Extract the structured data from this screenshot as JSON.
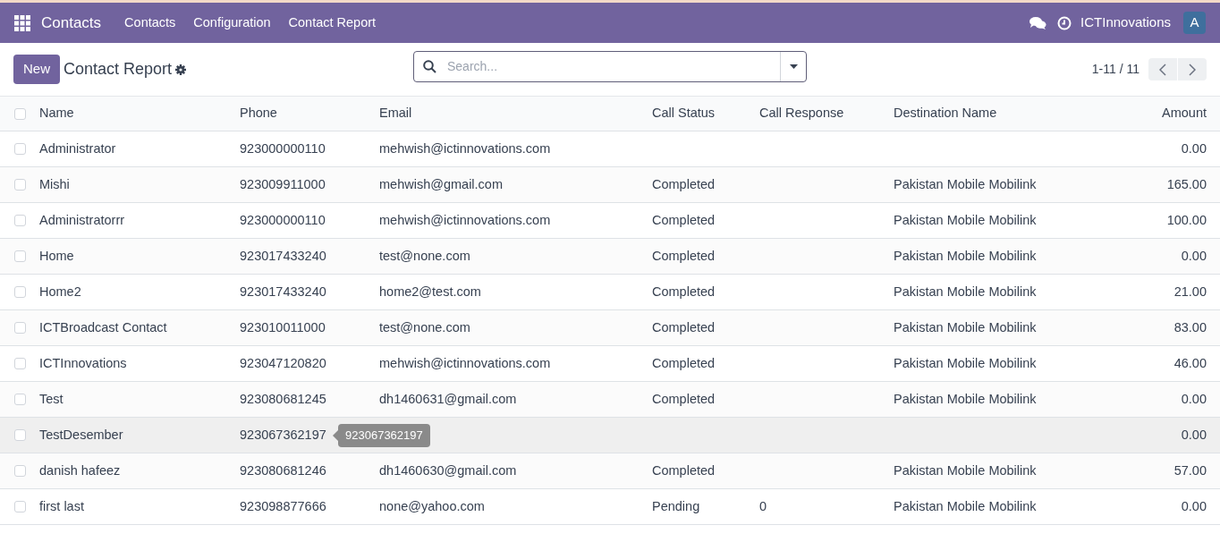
{
  "navbar": {
    "app_name": "Contacts",
    "menu": [
      "Contacts",
      "Configuration",
      "Contact Report"
    ],
    "company": "ICTInnovations",
    "avatar": "A"
  },
  "control_panel": {
    "new_button": "New",
    "title": "Contact Report",
    "search": {
      "placeholder": "Search..."
    },
    "pager": "1-11 / 11"
  },
  "table": {
    "select_all_checked": false,
    "columns": [
      "Name",
      "Phone",
      "Email",
      "Call Status",
      "Call Response",
      "Destination Name",
      "Amount"
    ],
    "rows": [
      {
        "cells": [
          "Administrator",
          "923000000110",
          "mehwish@ictinnovations.com",
          "",
          "",
          "",
          "0.00"
        ],
        "hovered": false,
        "checked": false
      },
      {
        "cells": [
          "Mishi",
          "923009911000",
          "mehwish@gmail.com",
          "Completed",
          "",
          "Pakistan Mobile Mobilink",
          "165.00"
        ],
        "hovered": false,
        "checked": false
      },
      {
        "cells": [
          "Administratorrr",
          "923000000110",
          "mehwish@ictinnovations.com",
          "Completed",
          "",
          "Pakistan Mobile Mobilink",
          "100.00"
        ],
        "hovered": false,
        "checked": false
      },
      {
        "cells": [
          "Home",
          "923017433240",
          "test@none.com",
          "Completed",
          "",
          "Pakistan Mobile Mobilink",
          "0.00"
        ],
        "hovered": false,
        "checked": false
      },
      {
        "cells": [
          "Home2",
          "923017433240",
          "home2@test.com",
          "Completed",
          "",
          "Pakistan Mobile Mobilink",
          "21.00"
        ],
        "hovered": false,
        "checked": false
      },
      {
        "cells": [
          "ICTBroadcast Contact",
          "923010011000",
          "test@none.com",
          "Completed",
          "",
          "Pakistan Mobile Mobilink",
          "83.00"
        ],
        "hovered": false,
        "checked": false
      },
      {
        "cells": [
          "ICTInnovations",
          "923047120820",
          "mehwish@ictinnovations.com",
          "Completed",
          "",
          "Pakistan Mobile Mobilink",
          "46.00"
        ],
        "hovered": false,
        "checked": false
      },
      {
        "cells": [
          "Test",
          "923080681245",
          "dh1460631@gmail.com",
          "Completed",
          "",
          "Pakistan Mobile Mobilink",
          "0.00"
        ],
        "hovered": false,
        "checked": false
      },
      {
        "cells": [
          "TestDesember",
          "923067362197",
          "",
          "",
          "",
          "",
          "0.00"
        ],
        "hovered": true,
        "checked": false,
        "tooltip": "923067362197"
      },
      {
        "cells": [
          "danish hafeez",
          "923080681246",
          "dh1460630@gmail.com",
          "Completed",
          "",
          "Pakistan Mobile Mobilink",
          "57.00"
        ],
        "hovered": false,
        "checked": false
      },
      {
        "cells": [
          "first last",
          "923098877666",
          "none@yahoo.com",
          "Pending",
          "0",
          "Pakistan Mobile Mobilink",
          "0.00"
        ],
        "hovered": false,
        "checked": false
      }
    ]
  }
}
